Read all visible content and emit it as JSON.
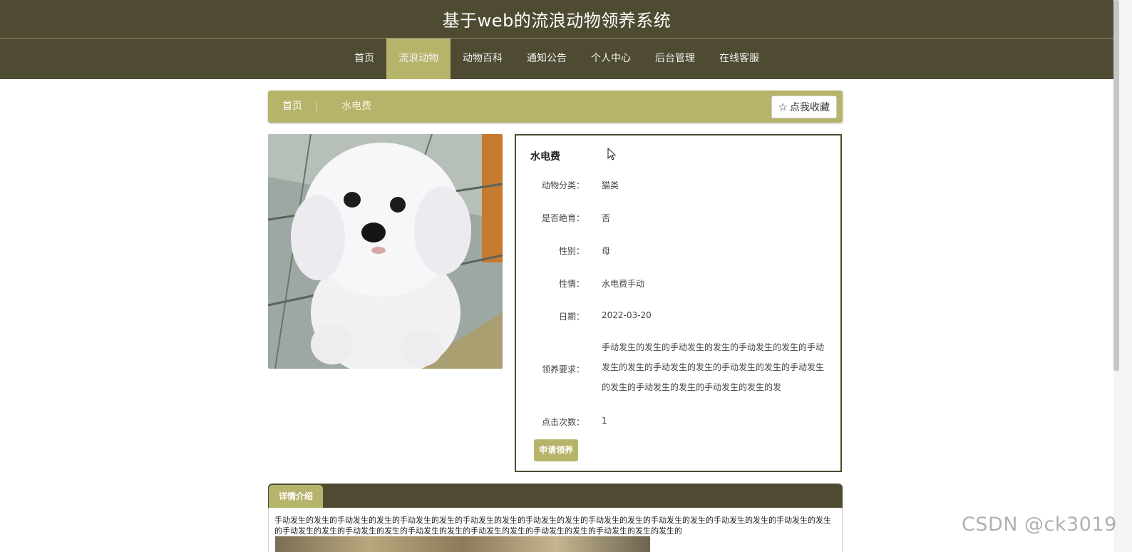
{
  "header": {
    "site_title": "基于web的流浪动物领养系统"
  },
  "nav": [
    {
      "label": "首页"
    },
    {
      "label": "流浪动物",
      "active": true
    },
    {
      "label": "动物百科"
    },
    {
      "label": "通知公告"
    },
    {
      "label": "个人中心"
    },
    {
      "label": "后台管理"
    },
    {
      "label": "在线客服"
    }
  ],
  "breadcrumb": {
    "home": "首页",
    "separator": "|",
    "current": "水电费"
  },
  "favorite_button": {
    "icon": "star-outline-icon",
    "label": "点我收藏"
  },
  "pet": {
    "name": "水电费",
    "fields": [
      {
        "label": "动物分类：",
        "value": "猫类"
      },
      {
        "label": "是否绝育：",
        "value": "否"
      },
      {
        "label": "性别：",
        "value": "母"
      },
      {
        "label": "性情：",
        "value": "水电费手动"
      },
      {
        "label": "日期：",
        "value": "2022-03-20"
      },
      {
        "label": "领养要求：",
        "value": "手动发生的发生的手动发生的发生的手动发生的发生的手动发生的发生的手动发生的发生的手动发生的发生的手动发生的发生的手动发生的发生的手动发生的发生的发"
      },
      {
        "label": "点击次数：",
        "value": "1"
      }
    ],
    "adopt_button": "申请领养"
  },
  "detail": {
    "tab_label": "详情介绍",
    "text": "手动发生的发生的手动发生的发生的手动发生的发生的手动发生的发生的手动发生的发生的手动发生的发生的手动发生的发生的手动发生的发生的手动发生的发生的手动发生的发生的手动发生的发生的手动发生的发生的手动发生的发生的手动发生的发生的手动发生的发生的发生的"
  },
  "watermark": "CSDN @ck3019",
  "colors": {
    "nav_bg": "#4e4b32",
    "accent": "#b6b36a"
  }
}
